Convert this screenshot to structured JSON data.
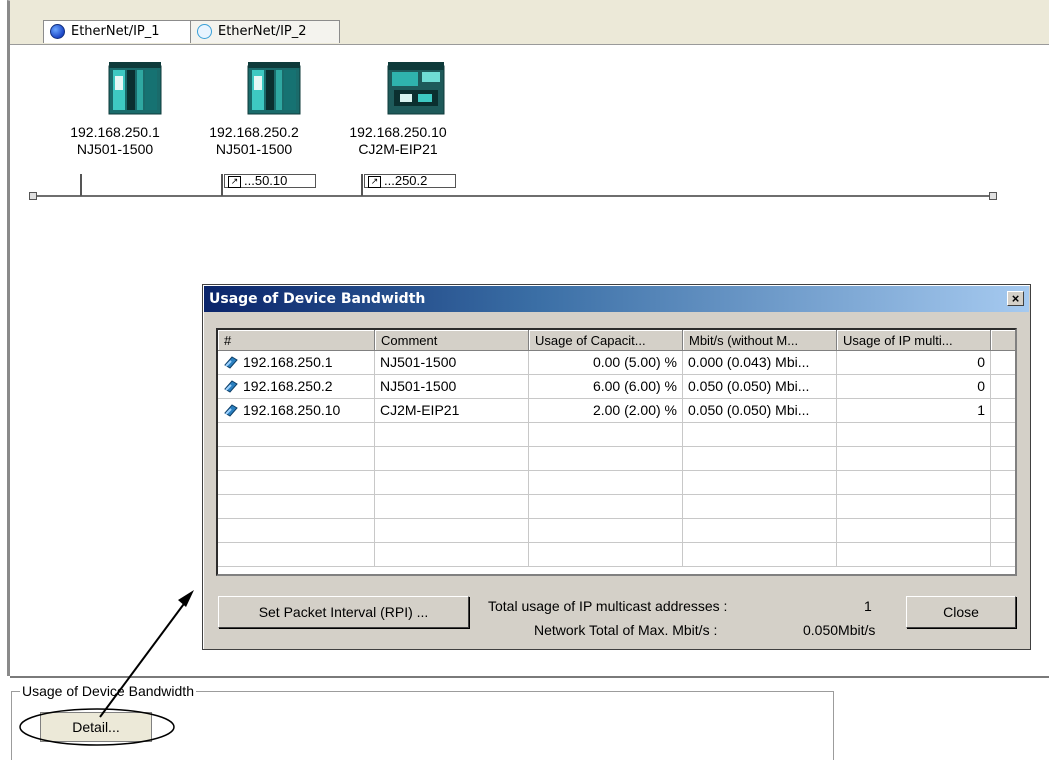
{
  "tabs": [
    {
      "label": "EtherNet/IP_1",
      "active": true
    },
    {
      "label": "EtherNet/IP_2",
      "active": false
    }
  ],
  "devices": [
    {
      "ip": "192.168.250.1",
      "model": "NJ501-1500",
      "link": ""
    },
    {
      "ip": "192.168.250.2",
      "model": "NJ501-1500",
      "link": "...50.10"
    },
    {
      "ip": "192.168.250.10",
      "model": "CJ2M-EIP21",
      "link": "...250.2"
    }
  ],
  "dialog": {
    "title": "Usage of Device Bandwidth",
    "close_glyph": "×",
    "columns": [
      "#",
      "Comment",
      "Usage of Capacit...",
      "Mbit/s (without M...",
      "Usage of IP multi..."
    ],
    "rows": [
      {
        "node": "192.168.250.1",
        "comment": "NJ501-1500",
        "capacity": "0.00 (5.00) %",
        "mbits": "0.000 (0.043) Mbi...",
        "multicast": "0"
      },
      {
        "node": "192.168.250.2",
        "comment": "NJ501-1500",
        "capacity": "6.00 (6.00) %",
        "mbits": "0.050 (0.050) Mbi...",
        "multicast": "0"
      },
      {
        "node": "192.168.250.10",
        "comment": "CJ2M-EIP21",
        "capacity": "2.00 (2.00) %",
        "mbits": "0.050 (0.050) Mbi...",
        "multicast": "1"
      }
    ],
    "set_packet_button": "Set Packet Interval (RPI) ...",
    "total_multicast_label": "Total usage of IP multicast addresses :",
    "total_multicast_value": "1",
    "network_total_label": "Network Total of Max. Mbit/s :",
    "network_total_value": "0.050Mbit/s",
    "close_button": "Close"
  },
  "bandwidth_group": {
    "label": "Usage of Device Bandwidth",
    "detail_button": "Detail..."
  },
  "icons": {
    "tab_globe": "globe-icon",
    "device": "plc-icon",
    "node": "node-icon",
    "link": "shortcut-arrow-icon"
  }
}
